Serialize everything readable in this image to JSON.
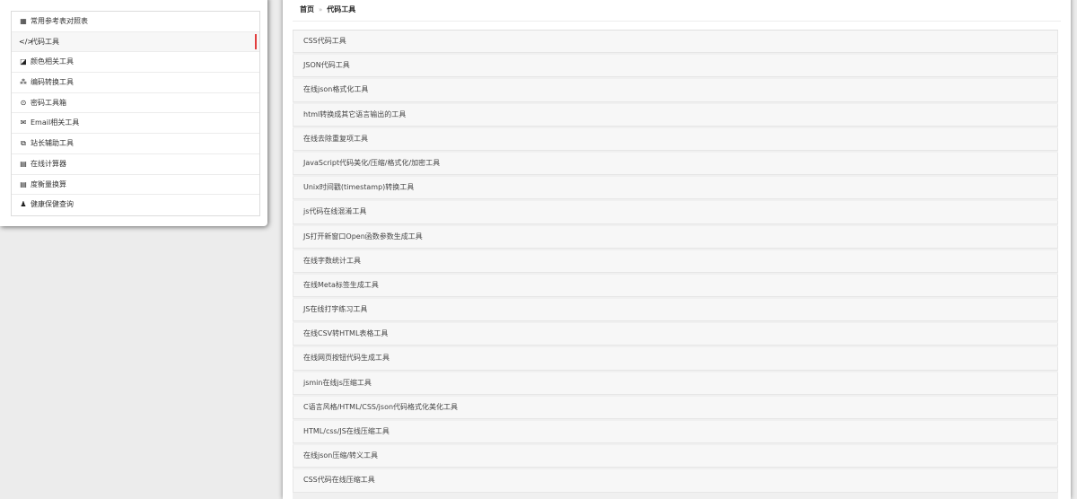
{
  "sidebar": {
    "items": [
      {
        "label": "常用参考表对照表",
        "icon": "table-icon",
        "glyph": "▦",
        "active": false
      },
      {
        "label": "代码工具",
        "icon": "code-icon",
        "glyph": "</>",
        "active": true
      },
      {
        "label": "颜色相关工具",
        "icon": "color-icon",
        "glyph": "◪",
        "active": false
      },
      {
        "label": "编码转换工具",
        "icon": "cubes-icon",
        "glyph": "⁂",
        "active": false
      },
      {
        "label": "密码工具箱",
        "icon": "lock-icon",
        "glyph": "⊙",
        "active": false
      },
      {
        "label": "Email相关工具",
        "icon": "envelope-icon",
        "glyph": "✉",
        "active": false
      },
      {
        "label": "站长辅助工具",
        "icon": "external-link-icon",
        "glyph": "⧉",
        "active": false
      },
      {
        "label": "在线计算器",
        "icon": "calculator-icon",
        "glyph": "▤",
        "active": false
      },
      {
        "label": "度衡量换算",
        "icon": "calculator-icon",
        "glyph": "▤",
        "active": false
      },
      {
        "label": "健康保健查询",
        "icon": "user-md-icon",
        "glyph": "♟",
        "active": false
      }
    ]
  },
  "breadcrumb": {
    "home": "首页",
    "separator": "»",
    "current": "代码工具"
  },
  "tools": [
    "CSS代码工具",
    "JSON代码工具",
    "在线json格式化工具",
    "html转换成其它语言输出的工具",
    "在线去除重复项工具",
    "JavaScript代码美化/压缩/格式化/加密工具",
    "Unix时间戳(timestamp)转换工具",
    "js代码在线混淆工具",
    "JS打开新窗口Open函数参数生成工具",
    "在线字数统计工具",
    "在线Meta标签生成工具",
    "JS在线打字练习工具",
    "在线CSV转HTML表格工具",
    "在线网页按钮代码生成工具",
    "jsmin在线js压缩工具",
    "C语言风格/HTML/CSS/json代码格式化美化工具",
    "HTML/css/JS在线压缩工具",
    "在线json压缩/转义工具",
    "CSS代码在线压缩工具"
  ],
  "colors": {
    "active_marker": "#e23d3d",
    "background": "#ececec"
  }
}
